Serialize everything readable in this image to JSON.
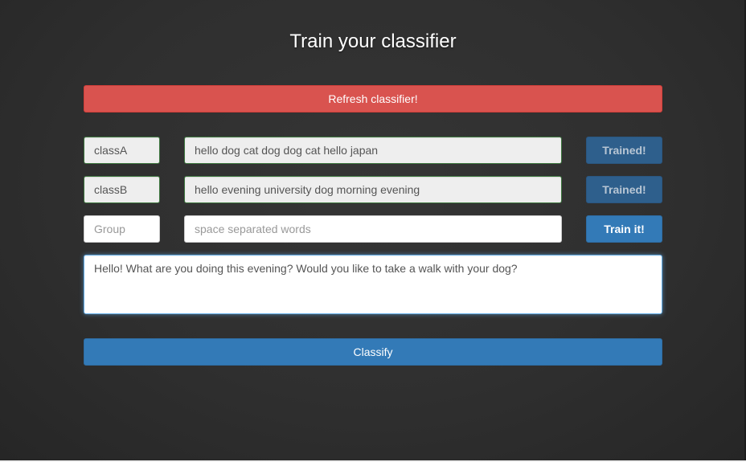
{
  "page": {
    "title": "Train your classifier"
  },
  "refresh_button": {
    "label": "Refresh classifier!",
    "color": "#d9534f"
  },
  "classes": [
    {
      "group": "classA",
      "words": "hello dog cat dog dog cat hello japan",
      "button_label": "Trained!",
      "trained": true
    },
    {
      "group": "classB",
      "words": "hello evening university dog morning evening",
      "button_label": "Trained!",
      "trained": true
    }
  ],
  "new_class": {
    "group_placeholder": "Group",
    "words_placeholder": "space separated words",
    "button_label": "Train it!"
  },
  "classify_input": {
    "value": "Hello! What are you doing this evening? Would you like to take a walk with your dog?"
  },
  "classify_button": {
    "label": "Classify",
    "color": "#337ab7"
  }
}
